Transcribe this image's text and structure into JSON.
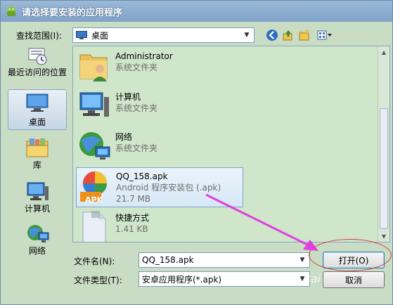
{
  "window": {
    "title": "请选择要安装的应用程序"
  },
  "lookin": {
    "label": "查找范围(I):",
    "value": "桌面"
  },
  "places": [
    {
      "label": "最近访问的位置",
      "icon": "recent-places-icon"
    },
    {
      "label": "桌面",
      "icon": "desktop-icon"
    },
    {
      "label": "库",
      "icon": "library-icon"
    },
    {
      "label": "计算机",
      "icon": "computer-icon"
    },
    {
      "label": "网络",
      "icon": "network-icon"
    }
  ],
  "files": [
    {
      "name": "Administrator",
      "type": "系统文件夹",
      "icon": "user-folder-icon"
    },
    {
      "name": "计算机",
      "type": "系统文件夹",
      "icon": "computer-icon"
    },
    {
      "name": "网络",
      "type": "系统文件夹",
      "icon": "network-globe-icon"
    },
    {
      "name": "QQ_158.apk",
      "type": "Android 程序安装包 (.apk)",
      "size": "21.7 MB",
      "icon": "apk-icon",
      "badge": "APK"
    },
    {
      "name": "快捷方式",
      "size": "1.41 KB",
      "icon": "shortcut-icon"
    }
  ],
  "filename": {
    "label": "文件名(N):",
    "value": "QQ_158.apk"
  },
  "filetype": {
    "label": "文件类型(T):",
    "value": "安卓应用程序(*.apk)"
  },
  "buttons": {
    "open": "打开(O)",
    "cancel": "取消"
  },
  "watermark": "Bai",
  "colors": {
    "annotation_arrow": "#e040e0",
    "annotation_ellipse": "#d23a3a",
    "list_background": "#cfe6cb",
    "title_bar": "#8aaed0"
  }
}
